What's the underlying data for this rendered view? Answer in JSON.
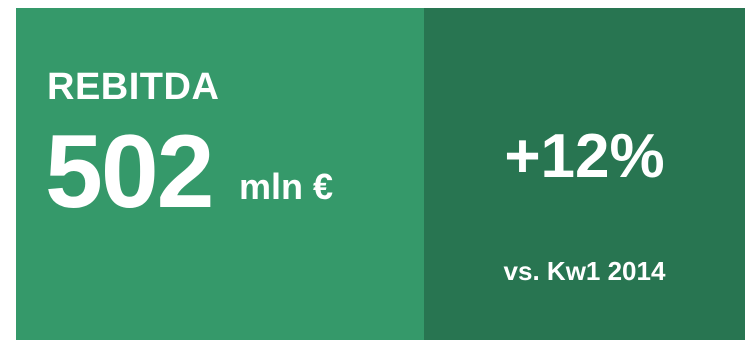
{
  "kpi": {
    "label": "REBITDA",
    "value": "502",
    "unit": "mln €",
    "change": "+12%",
    "comparison": "vs. Kw1 2014"
  },
  "colors": {
    "primary_panel": "#35996a",
    "secondary_panel": "#287551",
    "text": "#ffffff"
  }
}
